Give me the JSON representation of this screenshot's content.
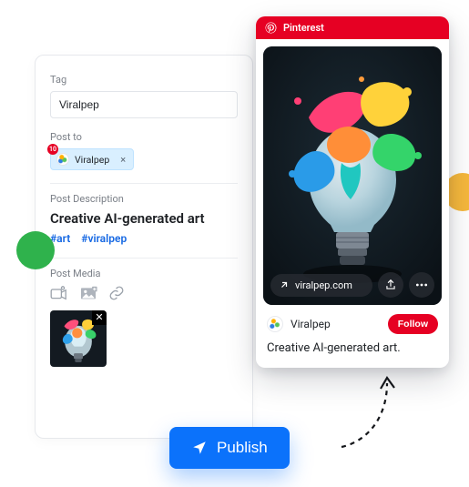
{
  "form": {
    "tag_label": "Tag",
    "tag_value": "Viralpep",
    "post_to_label": "Post to",
    "chip_name": "Viralpep",
    "chip_badge": "10",
    "desc_label": "Post Description",
    "desc_title": "Creative AI-generated art",
    "hashtags": [
      "#art",
      "#viralpep"
    ],
    "media_label": "Post Media"
  },
  "preview": {
    "brand": "Pinterest",
    "link_domain": "viralpep.com",
    "account_name": "Viralpep",
    "follow_label": "Follow",
    "caption": "Creative AI-generated art."
  },
  "publish_label": "Publish",
  "colors": {
    "primary": "#0b72fb",
    "pinterest_red": "#e60023",
    "link_blue": "#1668e3",
    "green": "#2fb24c",
    "yellow": "#f6b83c"
  }
}
